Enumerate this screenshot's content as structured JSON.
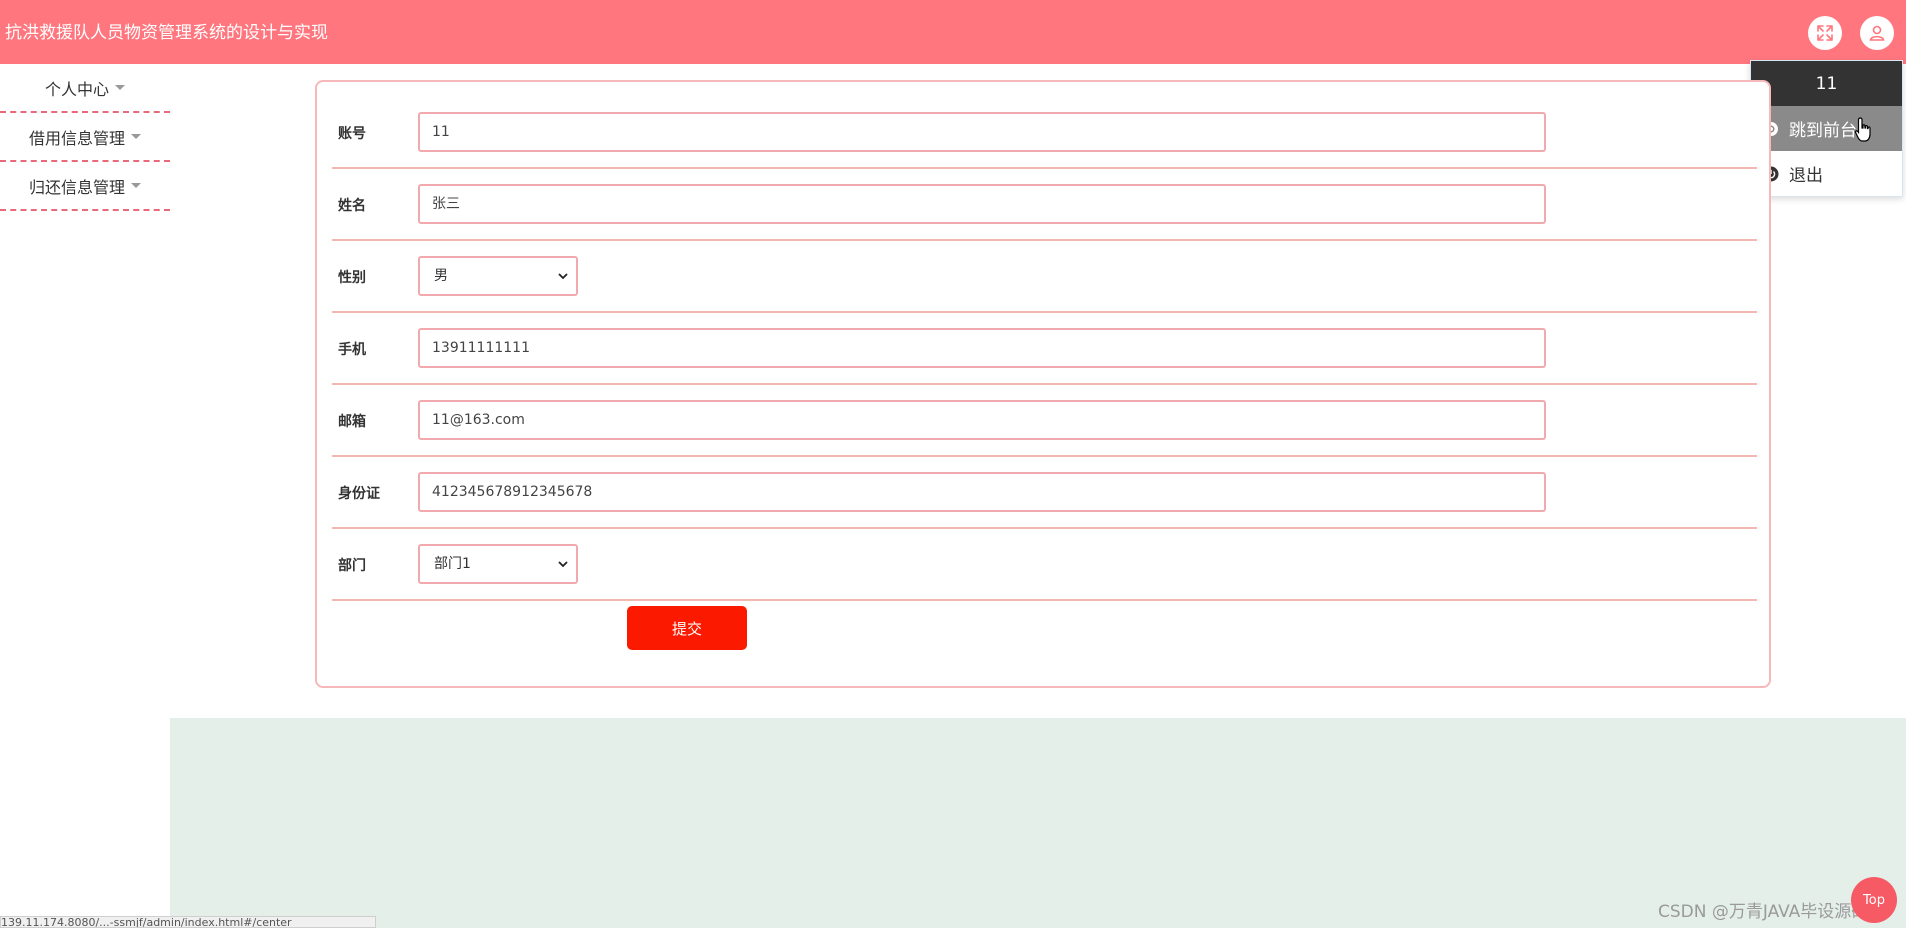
{
  "header": {
    "title": "抗洪救援队人员物资管理系统的设计与实现",
    "fullscreen_icon": "expand-icon",
    "user_icon": "user-icon"
  },
  "user_menu": {
    "username": "11",
    "items": [
      {
        "label": "跳到前台",
        "icon": "circle-icon"
      },
      {
        "label": "退出",
        "icon": "power-icon"
      }
    ]
  },
  "sidebar": {
    "items": [
      {
        "label": "个人中心"
      },
      {
        "label": "借用信息管理"
      },
      {
        "label": "归还信息管理"
      }
    ]
  },
  "form": {
    "fields": [
      {
        "label": "账号",
        "value": "11",
        "type": "text"
      },
      {
        "label": "姓名",
        "value": "张三",
        "type": "text"
      },
      {
        "label": "性别",
        "value": "男",
        "type": "select"
      },
      {
        "label": "手机",
        "value": "13911111111",
        "type": "text"
      },
      {
        "label": "邮箱",
        "value": "11@163.com",
        "type": "text"
      },
      {
        "label": "身份证",
        "value": "412345678912345678",
        "type": "text"
      },
      {
        "label": "部门",
        "value": "部门1",
        "type": "select"
      }
    ],
    "submit_label": "提交"
  },
  "footer": {
    "status_url": "139.11.174.8080/...-ssmjf/admin/index.html#/center",
    "watermark": "CSDN @万青JAVA毕设源码",
    "top_button": "Top"
  },
  "colors": {
    "header_bg": "#ff767e",
    "accent_red": "#fb1a00",
    "border_pink": "#f2a9ad",
    "content_bg": "#e5efea"
  }
}
